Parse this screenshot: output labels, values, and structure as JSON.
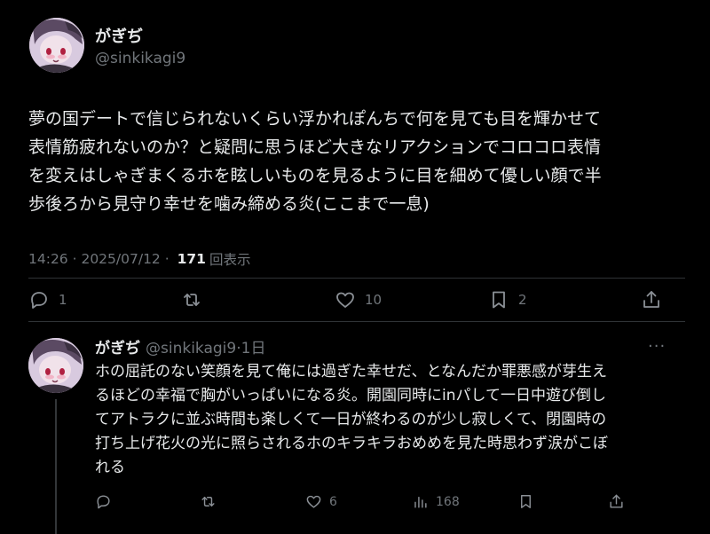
{
  "tweet": {
    "display_name": "がぎぢ",
    "handle": "@sinkikagi9",
    "text": "夢の国デートで信じられないくらい浮かれぽんちで何を見ても目を輝かせて\n表情筋疲れないのか？と疑問に思うほど大きなリアクションでコロコロ表情\nを変えはしゃぎまくるホを眩しいものを見るように目を細めて優しい顔で半\n歩後ろから見守り幸せを噛み締める炎(ここまで一息)",
    "time": "14:26",
    "date": "2025/07/12",
    "views_count": "171",
    "views_label": "回表示",
    "actions": {
      "reply_count": "1",
      "like_count": "10",
      "bookmark_count": "2"
    }
  },
  "reply": {
    "display_name": "がぎぢ",
    "handle": "@sinkikagi9",
    "age": "1日",
    "text": "ホの屈託のない笑顔を見て俺には過ぎた幸せだ、となんだか罪悪感が芽生え\nるほどの幸福で胸がいっぱいになる炎。開園同時にinパして一日中遊び倒し\nてアトラクに並ぶ時間も楽しくて一日が終わるのが少し寂しくて、閉園時の\n打ち上げ花火の光に照らされるホのキラキラおめめを見た時思わず涙がこぼ\nれる",
    "actions": {
      "like_count": "6",
      "views_count": "168"
    }
  },
  "colors": {
    "background": "#000000",
    "text": "#e7e9ea",
    "muted": "#71767b",
    "divider": "#2f3336"
  }
}
